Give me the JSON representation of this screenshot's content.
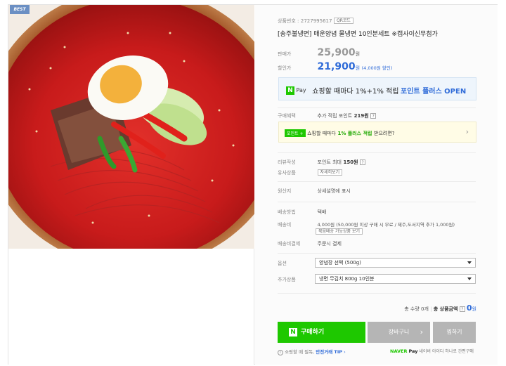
{
  "badge": "BEST",
  "product": {
    "number_label": "상품번호 :",
    "number_value": "2727995617",
    "qr_label": "QR코드",
    "title": "[송주불냉면] 매운양념 물냉면 10인분세트 ※캡사이신무첨가"
  },
  "price": {
    "list_label": "판매가",
    "list_value": "25,900",
    "list_unit": "원",
    "sale_label": "할인가",
    "sale_value": "21,900",
    "sale_unit": "원",
    "discount_note": "(4,000원 할인)"
  },
  "npay_banner": {
    "logo": "N",
    "pay": "Pay",
    "text": "쇼핑할 때마다 1%+1% 적립",
    "highlight": "포인트 플러스 OPEN"
  },
  "benefit": {
    "label": "구매혜택",
    "text": "추가 적립 포인트",
    "points": "219원"
  },
  "point_banner": {
    "tag": "포인트",
    "tag_plus": "+",
    "text_a": "쇼핑할 때마다",
    "highlight": "1% 플러스 적립",
    "text_b": "받으려면?"
  },
  "review": {
    "label": "리뷰작성",
    "text": "포인트 최대",
    "points": "150원"
  },
  "similar": {
    "label": "유사상품",
    "button": "자세히보기"
  },
  "origin": {
    "label": "원산지",
    "value": "상세설명에 표시"
  },
  "shipping_method": {
    "label": "배송방법",
    "value": "택배"
  },
  "shipping_fee": {
    "label": "배송비",
    "value": "4,000원 (50,000원 이상 구매 시 무료 / 제주,도서지역 추가 1,000원)",
    "button": "묶음배송 가능상품 보기"
  },
  "shipping_pay": {
    "label": "배송비결제",
    "value": "주문시 결제"
  },
  "option": {
    "label": "옵션",
    "selected": "양념장 선택 (500g)"
  },
  "addon": {
    "label": "추가상품",
    "selected": "냉면 무김치 800g 10인분"
  },
  "total": {
    "qty_label": "총 수량",
    "qty_value": "0개",
    "amount_label": "총 상품금액",
    "amount_value": "0",
    "amount_unit": "원"
  },
  "actions": {
    "buy": "구매하기",
    "cart": "장바구니",
    "wish": "찜하기"
  },
  "footer": {
    "notice": "쇼핑할 때 필독,",
    "tip": "안전거래 TIP",
    "naver": "NAVER",
    "pay": "Pay",
    "right_text": "네이버 아이디 하나로 간편구매"
  },
  "colors": {
    "npay_green": "#1ec800",
    "sale_blue": "#2f6bd8",
    "badge_blue": "#6b8fc3"
  }
}
